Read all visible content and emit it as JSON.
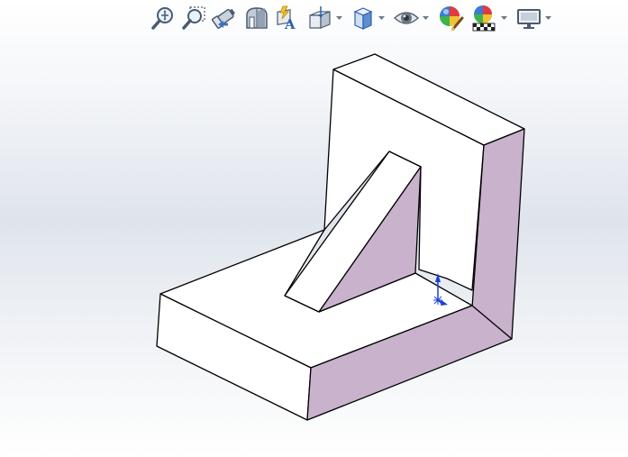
{
  "toolbar": {
    "items": [
      {
        "icon": "zoom-to-fit-icon",
        "has_dropdown": false
      },
      {
        "icon": "zoom-to-area-icon",
        "has_dropdown": false
      },
      {
        "icon": "previous-view-icon",
        "has_dropdown": false
      },
      {
        "icon": "section-view-icon",
        "has_dropdown": false
      },
      {
        "icon": "dynamic-annotation-views-icon",
        "has_dropdown": false
      },
      {
        "icon": "view-orientation-icon",
        "has_dropdown": true
      },
      {
        "icon": "display-style-icon",
        "has_dropdown": true
      },
      {
        "icon": "hide-show-items-icon",
        "has_dropdown": true
      },
      {
        "icon": "edit-appearance-icon",
        "has_dropdown": false
      },
      {
        "icon": "apply-scene-icon",
        "has_dropdown": true
      },
      {
        "icon": "view-settings-icon",
        "has_dropdown": true
      }
    ]
  },
  "colors": {
    "model_face": "#ffffff",
    "model_shaded_face": "#c8b2cc",
    "model_edge": "#000000",
    "triad": "#1a3fd6",
    "background_top": "#ffffff",
    "background_mid": "#dfe4ec"
  }
}
